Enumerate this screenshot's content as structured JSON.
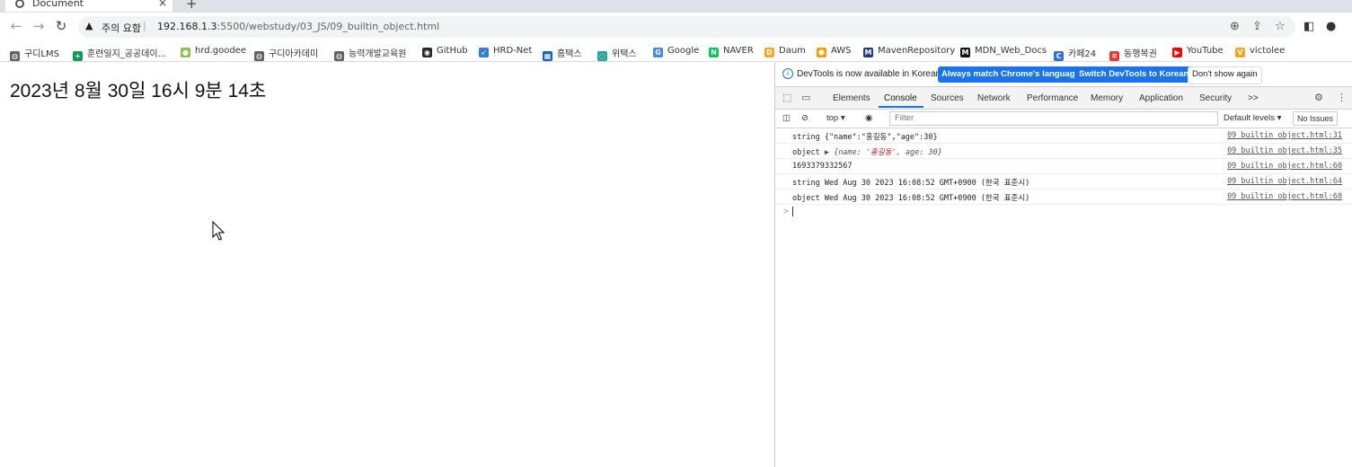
{
  "browser": {
    "tab_title": "Document",
    "tab_close": "×",
    "new_tab": "+",
    "window_minimize": "–",
    "security_label": "주의 요함",
    "url_host": "192.168.1.3",
    "url_path": ":5500/webstudy/03_JS/09_builtin_object.html"
  },
  "bookmarks": [
    {
      "label": "구디LMS",
      "color": "#5f6368",
      "icon": "globe-icon"
    },
    {
      "label": "훈련일지_공공데이...",
      "color": "#0f9d58",
      "icon": "plus-icon"
    },
    {
      "label": "hrd.goodee",
      "color": "#8bc34a",
      "icon": "leaf-icon"
    },
    {
      "label": "구디아카데미",
      "color": "#5f6368",
      "icon": "globe-icon"
    },
    {
      "label": "능력개발교육원",
      "color": "#5f6368",
      "icon": "globe-icon"
    },
    {
      "label": "GitHub",
      "color": "#24292e",
      "icon": "github-icon"
    },
    {
      "label": "HRD-Net",
      "color": "#2e7dd7",
      "icon": "hrdnet-icon"
    },
    {
      "label": "홈택스",
      "color": "#1565c0",
      "icon": "hometax-icon"
    },
    {
      "label": "위택스",
      "color": "#26a69a",
      "icon": "wetax-icon"
    },
    {
      "label": "Google",
      "color": "#4285f4",
      "icon": "google-icon"
    },
    {
      "label": "NAVER",
      "color": "#03c75a",
      "icon": "naver-icon"
    },
    {
      "label": "Daum",
      "color": "#f5a623",
      "icon": "daum-icon"
    },
    {
      "label": "AWS",
      "color": "#ff9900",
      "icon": "aws-icon"
    },
    {
      "label": "MavenRepository",
      "color": "#1e3a8a",
      "icon": "maven-icon"
    },
    {
      "label": "MDN_Web_Docs",
      "color": "#111111",
      "icon": "mdn-icon"
    },
    {
      "label": "카페24",
      "color": "#2f6fde",
      "icon": "cafe24-icon"
    },
    {
      "label": "동행복권",
      "color": "#e53935",
      "icon": "lotto-icon"
    },
    {
      "label": "YouTube",
      "color": "#ff0000",
      "icon": "youtube-icon"
    },
    {
      "label": "victolee",
      "color": "#f5a623",
      "icon": "victolee-icon"
    }
  ],
  "page": {
    "clock_text": "2023년 8월 30일 16시 9분 14초"
  },
  "devtools": {
    "info_message": "DevTools is now available in Korean!",
    "btn_match": "Always match Chrome's language",
    "btn_switch": "Switch DevTools to Korean",
    "btn_dont_show": "Don't show again",
    "tabs": [
      "Elements",
      "Console",
      "Sources",
      "Network",
      "Performance",
      "Memory",
      "Application",
      "Security",
      ">>"
    ],
    "active_tab": "Console",
    "context": "top",
    "filter_placeholder": "Filter",
    "levels": "Default levels ▾",
    "issues": "No Issues",
    "logs": [
      {
        "text": "string {\"name\":\"홍길동\",\"age\":30}",
        "source": "09_builtin_object.html:31"
      },
      {
        "text_prefix": "object ",
        "object_key_name": "name: ",
        "object_val_name": "'홍길동'",
        "object_rest": ", age: 30}",
        "object_open": "▶ {",
        "source": "09_builtin_object.html:35"
      },
      {
        "text": "1693379332567",
        "source": "09_builtin_object.html:60"
      },
      {
        "text": "string Wed Aug 30 2023 16:08:52 GMT+0900 (한국 표준시)",
        "source": "09_builtin_object.html:64"
      },
      {
        "text": "object Wed Aug 30 2023 16:08:52 GMT+0900 (한국 표준시)",
        "source": "09_builtin_object.html:68"
      }
    ],
    "prompt_symbol": ">"
  }
}
